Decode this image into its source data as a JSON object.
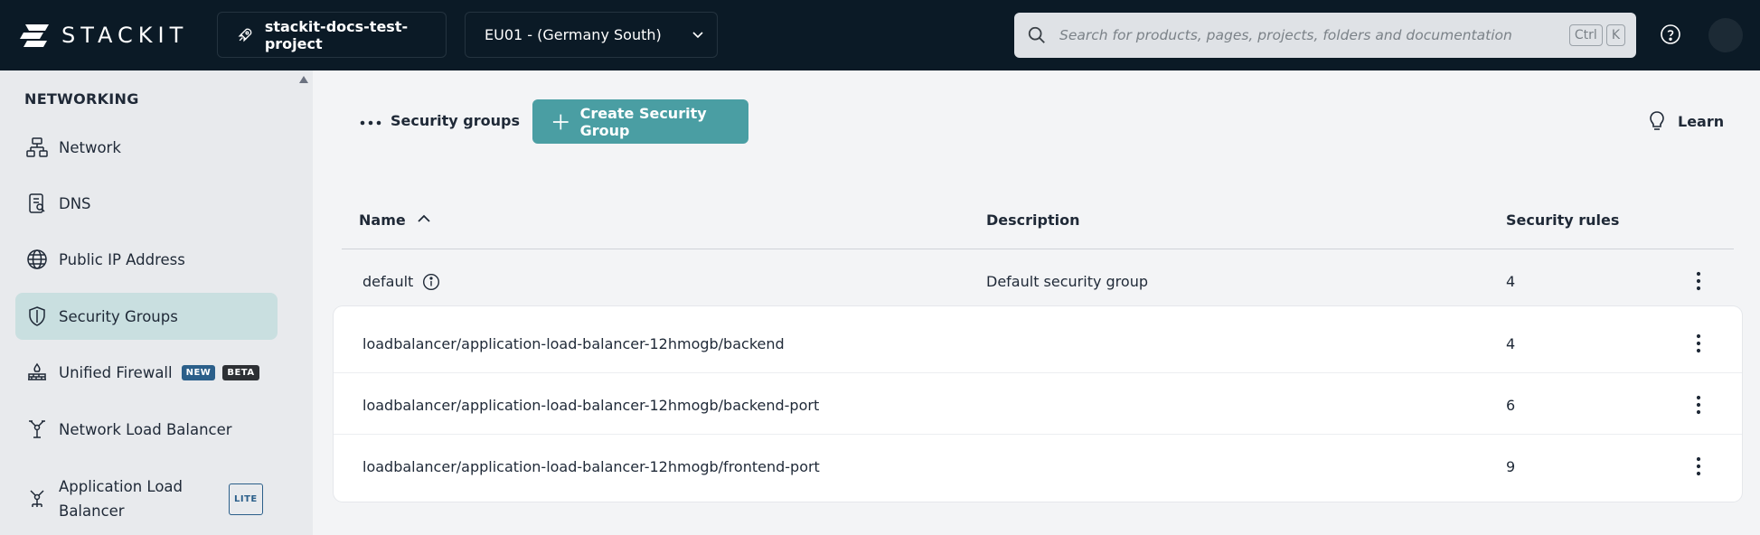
{
  "header": {
    "logo_text": "STACKIT",
    "project_name": "stackit-docs-test-project",
    "region": "EU01 - (Germany South)",
    "search_placeholder": "Search for products, pages, projects, folders and documentation",
    "shortcut_keys": [
      "Ctrl",
      "K"
    ]
  },
  "sidebar": {
    "section_title": "NETWORKING",
    "items": [
      {
        "label": "Network",
        "icon": "network-icon"
      },
      {
        "label": "DNS",
        "icon": "dns-icon"
      },
      {
        "label": "Public IP Address",
        "icon": "globe-icon"
      },
      {
        "label": "Security Groups",
        "icon": "shield-icon",
        "active": true
      },
      {
        "label": "Unified Firewall",
        "icon": "firewall-icon",
        "badges": [
          "NEW",
          "BETA"
        ]
      },
      {
        "label": "Network Load Balancer",
        "icon": "load-balancer-icon"
      },
      {
        "label_line1": "Application Load",
        "label_line2": "Balancer",
        "icon": "application-load-balancer-icon",
        "badges": [
          "LITE"
        ]
      }
    ]
  },
  "toolbar": {
    "breadcrumb": "Security groups",
    "create_label": "Create Security Group",
    "learn_label": "Learn"
  },
  "table": {
    "columns": [
      "Name",
      "Description",
      "Security rules"
    ],
    "rows": [
      {
        "name": "default",
        "description": "Default security group",
        "rules": "4"
      },
      {
        "name": "loadbalancer/application-load-balancer-12hmogb/backend",
        "description": "",
        "rules": "4"
      },
      {
        "name": "loadbalancer/application-load-balancer-12hmogb/backend-port",
        "description": "",
        "rules": "6"
      },
      {
        "name": "loadbalancer/application-load-balancer-12hmogb/frontend-port",
        "description": "",
        "rules": "9"
      }
    ]
  },
  "colors": {
    "topbar_bg": "#0b1a26",
    "accent": "#4a9ea3",
    "active_nav": "#c9dfe0"
  }
}
